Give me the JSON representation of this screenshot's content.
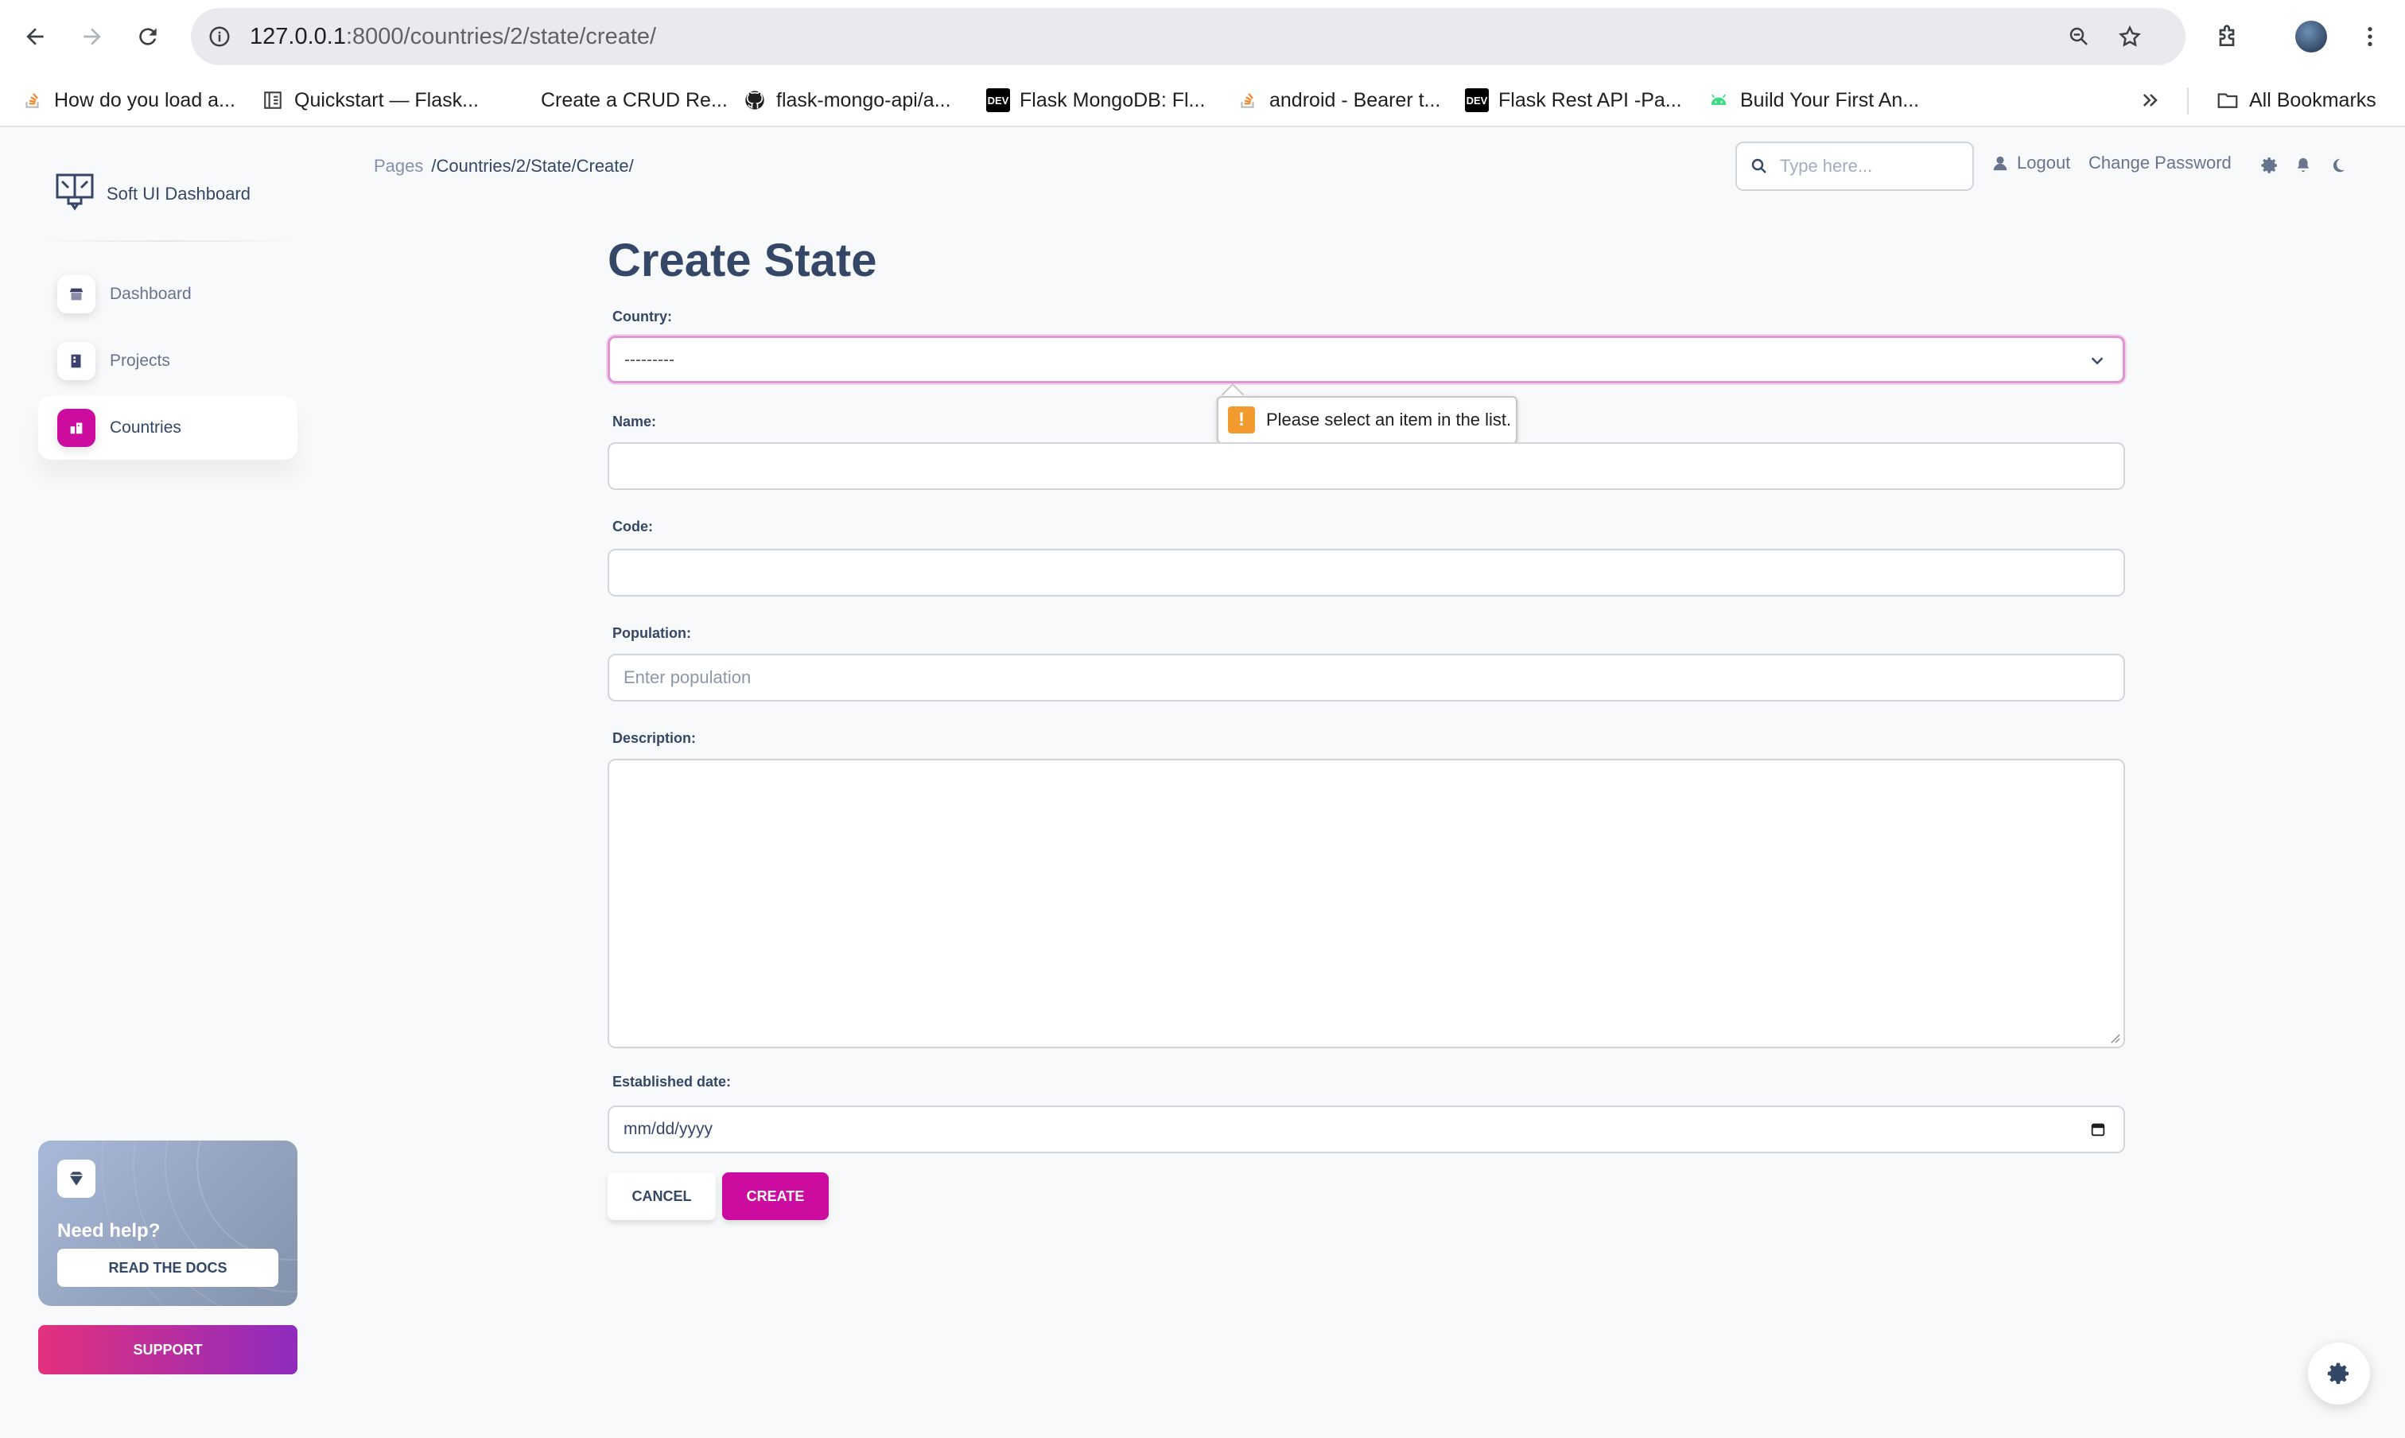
{
  "browser": {
    "url_host": "127.0.0.1",
    "url_rest": ":8000/countries/2/state/create/",
    "bookmarks": [
      {
        "label": "How do you load a...",
        "icon": "stackoverflow-icon"
      },
      {
        "label": "Quickstart — Flask...",
        "icon": "flask-docs-icon"
      },
      {
        "label": "Create a CRUD Re...",
        "icon": "blank-icon"
      },
      {
        "label": "flask-mongo-api/a...",
        "icon": "github-icon"
      },
      {
        "label": "Flask MongoDB: Fl...",
        "icon": "dev-icon"
      },
      {
        "label": "android - Bearer t...",
        "icon": "stackoverflow-icon"
      },
      {
        "label": "Flask Rest API -Pa...",
        "icon": "dev-icon"
      },
      {
        "label": "Build Your First An...",
        "icon": "android-icon"
      }
    ],
    "all_bookmarks": "All Bookmarks",
    "dev_badge": "DEV"
  },
  "sidebar": {
    "brand": "Soft UI Dashboard",
    "items": [
      {
        "label": "Dashboard",
        "active": false
      },
      {
        "label": "Projects",
        "active": false
      },
      {
        "label": "Countries",
        "active": true
      }
    ],
    "help": {
      "title": "Need help?",
      "button": "READ THE DOCS"
    },
    "support": "SUPPORT"
  },
  "topbar": {
    "breadcrumb_root": "Pages",
    "breadcrumb_current": "/Countries/2/State/Create/",
    "search_placeholder": "Type here...",
    "logout": "Logout",
    "change_password": "Change Password"
  },
  "form": {
    "title": "Create State",
    "country_label": "Country:",
    "country_value": "---------",
    "validation_message": "Please select an item in the list.",
    "name_label": "Name:",
    "code_label": "Code:",
    "population_label": "Population:",
    "population_placeholder": "Enter population",
    "description_label": "Description:",
    "date_label": "Established date:",
    "date_placeholder": "mm/dd/yyyy",
    "cancel": "CANCEL",
    "create": "CREATE"
  },
  "colors": {
    "accent": "#cb0c9f",
    "text": "#344767",
    "muted": "#67748e"
  }
}
